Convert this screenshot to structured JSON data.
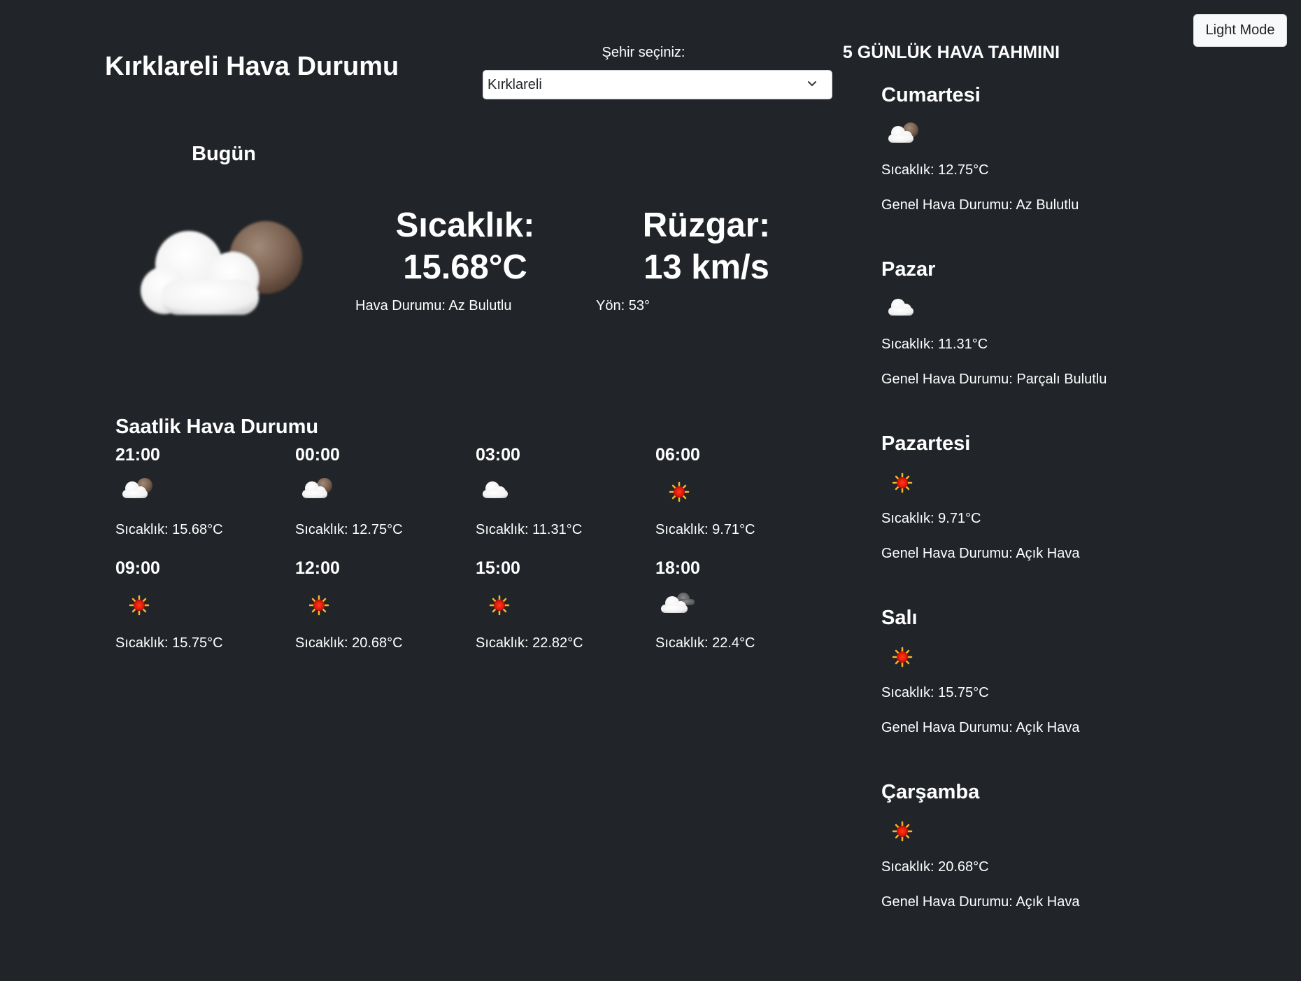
{
  "header": {
    "title": "Kırklareli Hava Durumu",
    "mode_button": "Light Mode",
    "city_label": "Şehir seçiniz:",
    "city_selected": "Kırklareli"
  },
  "today": {
    "label": "Bugün",
    "icon": "few-clouds-icon",
    "temp_title": "Sıcaklık:",
    "temp_value": "15.68°C",
    "condition": "Hava Durumu: Az Bulutlu",
    "wind_title": "Rüzgar:",
    "wind_value": "13 km/s",
    "direction": "Yön: 53°"
  },
  "hourly": {
    "title": "Saatlik Hava Durumu",
    "items": [
      {
        "time": "21:00",
        "icon": "few-clouds-icon",
        "temp": "Sıcaklık: 15.68°C"
      },
      {
        "time": "00:00",
        "icon": "few-clouds-icon",
        "temp": "Sıcaklık: 12.75°C"
      },
      {
        "time": "03:00",
        "icon": "cloud-icon",
        "temp": "Sıcaklık: 11.31°C"
      },
      {
        "time": "06:00",
        "icon": "sun-icon",
        "temp": "Sıcaklık: 9.71°C"
      },
      {
        "time": "09:00",
        "icon": "sun-icon",
        "temp": "Sıcaklık: 15.75°C"
      },
      {
        "time": "12:00",
        "icon": "sun-icon",
        "temp": "Sıcaklık: 20.68°C"
      },
      {
        "time": "15:00",
        "icon": "sun-icon",
        "temp": "Sıcaklık: 22.82°C"
      },
      {
        "time": "18:00",
        "icon": "few-clouds-night-icon",
        "temp": "Sıcaklık: 22.4°C"
      }
    ]
  },
  "forecast": {
    "title": "5 GÜNLÜK HAVA TAHMINI",
    "days": [
      {
        "day": "Cumartesi",
        "icon": "few-clouds-icon",
        "temp": "Sıcaklık: 12.75°C",
        "condition": "Genel Hava Durumu: Az Bulutlu"
      },
      {
        "day": "Pazar",
        "icon": "cloud-icon",
        "temp": "Sıcaklık: 11.31°C",
        "condition": "Genel Hava Durumu: Parçalı Bulutlu"
      },
      {
        "day": "Pazartesi",
        "icon": "sun-icon",
        "temp": "Sıcaklık: 9.71°C",
        "condition": "Genel Hava Durumu: Açık Hava"
      },
      {
        "day": "Salı",
        "icon": "sun-icon",
        "temp": "Sıcaklık: 15.75°C",
        "condition": "Genel Hava Durumu: Açık Hava"
      },
      {
        "day": "Çarşamba",
        "icon": "sun-icon",
        "temp": "Sıcaklık: 20.68°C",
        "condition": "Genel Hava Durumu: Açık Hava"
      }
    ]
  }
}
